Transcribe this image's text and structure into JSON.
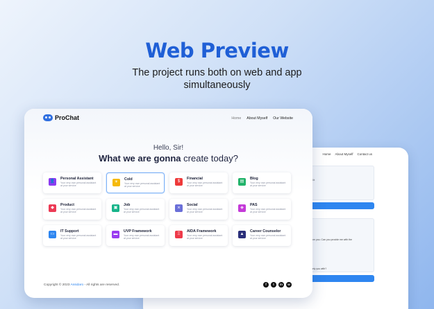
{
  "hero": {
    "title": "Web Preview",
    "subtitle": "The project runs both on web and app simultaneously",
    "accent_color": "#1f5fd6"
  },
  "back_window": {
    "nav": [
      "Home",
      "About Myself",
      "Contact us"
    ],
    "panel1_text": "ell it",
    "panel2_text": "from you. Can you provide me with the",
    "panel2_text2": "ately you with?"
  },
  "app": {
    "brand": "ProChat",
    "nav": [
      "Home",
      "About Myself",
      "Our Website"
    ],
    "greeting": "Hello, Sir!",
    "title_bold": "What we are gonna",
    "title_light": "create today?",
    "cards": [
      {
        "name": "Personal Assistant",
        "desc": "Your very own personal assistant at your service",
        "icon": "person-icon",
        "color": "#8b3cf0"
      },
      {
        "name": "Cold",
        "desc": "Your very own personal assistant at your service",
        "icon": "sun-icon",
        "color": "#f5b90a"
      },
      {
        "name": "Financial",
        "desc": "Your very own personal assistant at your service",
        "icon": "finance-icon",
        "color": "#ee3a3a"
      },
      {
        "name": "Blog",
        "desc": "Your very own personal assistant at your service",
        "icon": "blog-icon",
        "color": "#22b36a"
      },
      {
        "name": "Product",
        "desc": "Your very own personal assistant at your service",
        "icon": "product-icon",
        "color": "#ec3a55"
      },
      {
        "name": "Job",
        "desc": "Your very own personal assistant at your service",
        "icon": "briefcase-icon",
        "color": "#18b48a"
      },
      {
        "name": "Social",
        "desc": "Your very own personal assistant at your service",
        "icon": "social-icon",
        "color": "#6a6fd8"
      },
      {
        "name": "PAS",
        "desc": "Your very own personal assistant at your service",
        "icon": "pas-icon",
        "color": "#c43ad8"
      },
      {
        "name": "IT Support",
        "desc": "Your very own personal assistant at your service",
        "icon": "support-icon",
        "color": "#2e86f0"
      },
      {
        "name": "UVP Framework",
        "desc": "Your very own personal assistant at your service",
        "icon": "framework-icon",
        "color": "#9a3cf0"
      },
      {
        "name": "AIDA Framework",
        "desc": "Your very own personal assistant at your service",
        "icon": "aida-icon",
        "color": "#ee3a4a"
      },
      {
        "name": "Career Counselor",
        "desc": "Your very own personal assistant at your service",
        "icon": "career-icon",
        "color": "#2a2f7a"
      }
    ],
    "footer_prefix": "Copyright © 2023",
    "footer_brand": "Assidaro",
    "footer_suffix": "- All rights are reserved.",
    "social": [
      "facebook-icon",
      "twitter-icon",
      "linkedin-icon",
      "whatsapp-icon"
    ]
  }
}
